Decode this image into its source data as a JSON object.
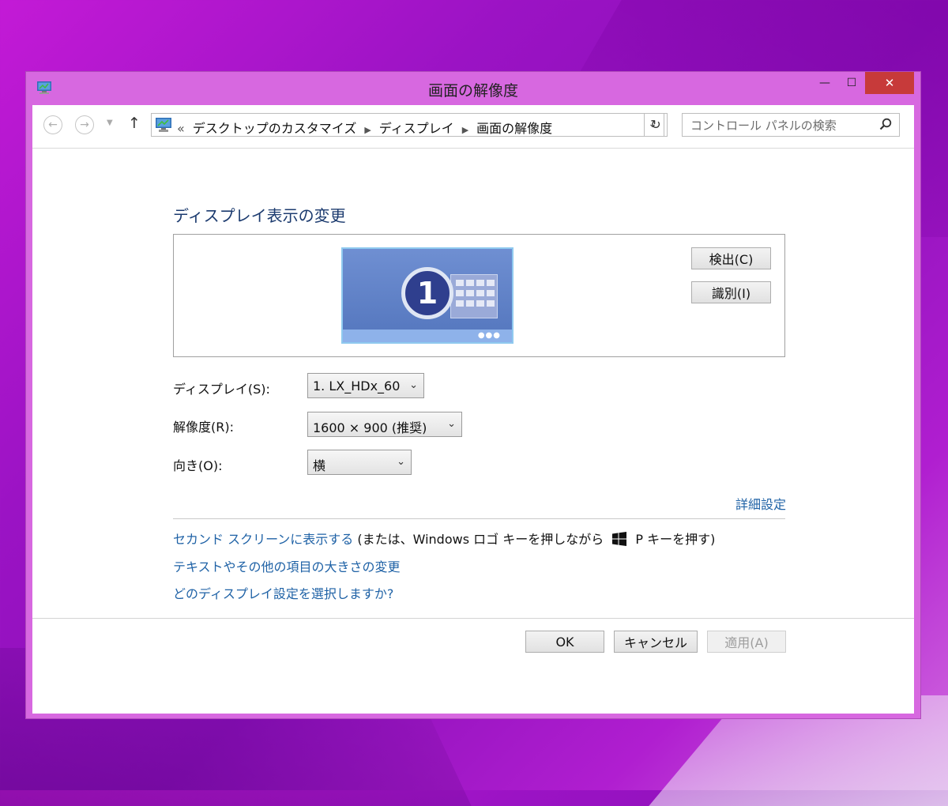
{
  "window": {
    "title": "画面の解像度",
    "controls": {
      "minimize": "—",
      "maximize": "☐",
      "close": "✕"
    }
  },
  "nav": {
    "breadcrumb_lead": "«",
    "breadcrumb": [
      "デスクトップのカスタマイズ",
      "ディスプレイ",
      "画面の解像度"
    ],
    "search_placeholder": "コントロール パネルの検索"
  },
  "main": {
    "heading": "ディスプレイ表示の変更",
    "monitor_number": "1",
    "detect_button": "検出(C)",
    "identify_button": "識別(I)",
    "display_label": "ディスプレイ(S):",
    "display_value": "1. LX_HDx_60",
    "resolution_label": "解像度(R):",
    "resolution_value": "1600 × 900 (推奨)",
    "orientation_label": "向き(O):",
    "orientation_value": "横",
    "advanced_link": "詳細設定",
    "second_screen_link": "セカンド スクリーンに表示する",
    "second_screen_note_a": " (または、Windows ロゴ キーを押しながら ",
    "second_screen_note_b": " P キーを押す)",
    "text_size_link": "テキストやその他の項目の大きさの変更",
    "which_settings_link": "どのディスプレイ設定を選択しますか?"
  },
  "footer": {
    "ok": "OK",
    "cancel": "キャンセル",
    "apply": "適用(A)"
  },
  "colors": {
    "window_border": "#d768e0",
    "link": "#1f62a6",
    "heading": "#1c3b6f",
    "close_button": "#c73a3a"
  }
}
